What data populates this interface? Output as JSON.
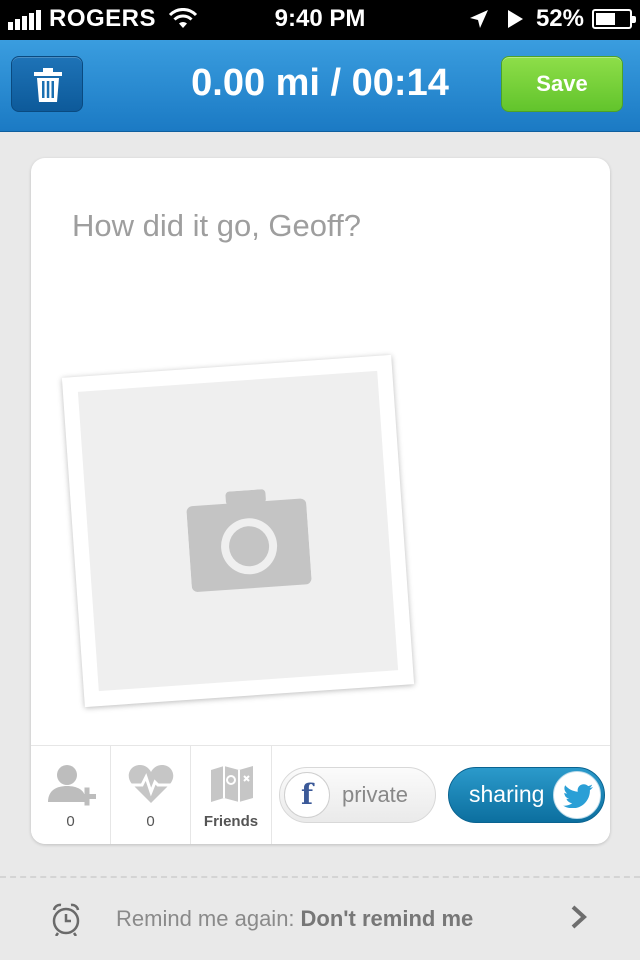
{
  "status_bar": {
    "carrier": "ROGERS",
    "time": "9:40 PM",
    "battery": "52%",
    "icons": [
      "signal-icon",
      "wifi-icon",
      "location-icon",
      "play-icon",
      "battery-icon"
    ]
  },
  "header": {
    "title": "0.00 mi / 00:14",
    "save_label": "Save",
    "delete_icon": "trash-icon",
    "color": "#2288d0",
    "save_color": "#72cf38"
  },
  "card": {
    "prompt": "How did it go, Geoff?",
    "photo_icon": "camera-icon",
    "stats": {
      "add_friend_count": "0",
      "heart_count": "0",
      "friends_label": "Friends"
    },
    "facebook": {
      "label": "private",
      "icon": "f"
    },
    "twitter": {
      "label": "sharing",
      "icon": "twitter-bird-icon",
      "color": "#1a85b8"
    }
  },
  "reminder": {
    "label": "Remind me again:",
    "value": "Don't remind me",
    "icons": [
      "alarm-clock-icon",
      "chevron-right-icon"
    ]
  }
}
